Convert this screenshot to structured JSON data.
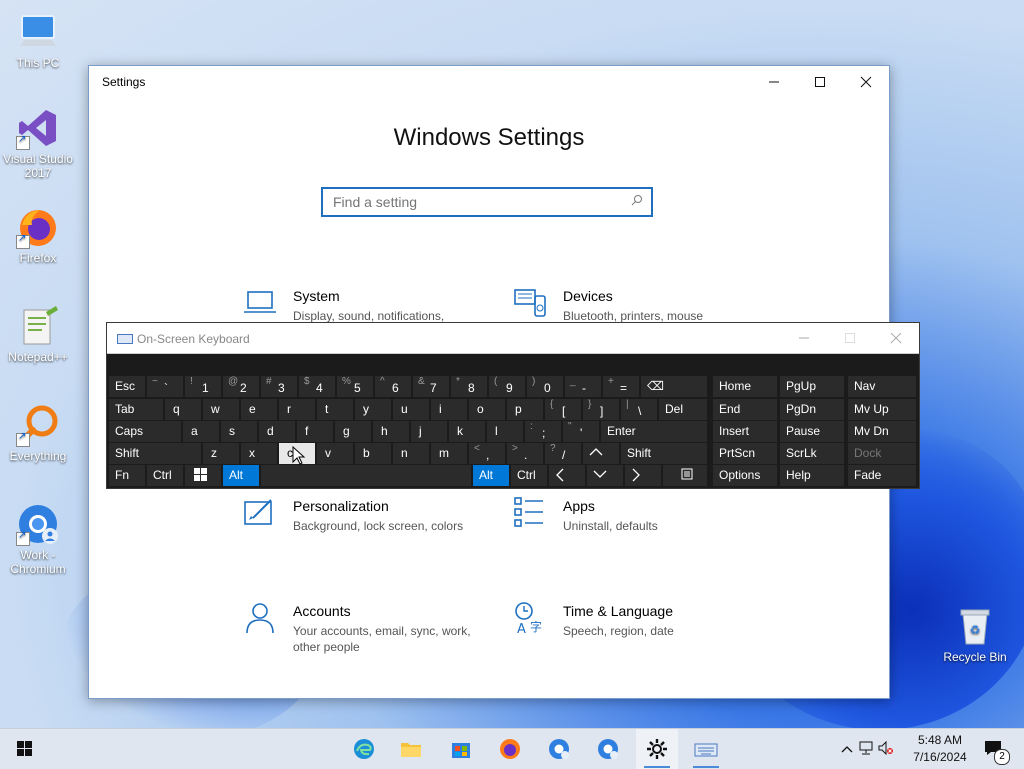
{
  "desktop": {
    "icons": [
      {
        "label": "This PC"
      },
      {
        "label": "Visual Studio 2017"
      },
      {
        "label": "Firefox"
      },
      {
        "label": "Notepad++"
      },
      {
        "label": "Everything"
      },
      {
        "label": "Work - Chromium"
      },
      {
        "label": "Recycle Bin"
      }
    ]
  },
  "settings": {
    "window_title": "Settings",
    "heading": "Windows Settings",
    "search_placeholder": "Find a setting",
    "tiles": [
      {
        "name": "System",
        "desc": "Display, sound, notifications,",
        "icon": "laptop-icon"
      },
      {
        "name": "Devices",
        "desc": "Bluetooth, printers, mouse",
        "icon": "devices-icon"
      },
      {
        "name": "Personalization",
        "desc": "Background, lock screen, colors",
        "icon": "personalization-icon"
      },
      {
        "name": "Apps",
        "desc": "Uninstall, defaults",
        "icon": "apps-icon"
      },
      {
        "name": "Accounts",
        "desc": "Your accounts, email, sync, work, other people",
        "icon": "person-icon"
      },
      {
        "name": "Time & Language",
        "desc": "Speech, region, date",
        "icon": "time-language-icon"
      }
    ]
  },
  "osk": {
    "title": "On-Screen Keyboard",
    "row1": {
      "esc": "Esc",
      "keys": [
        {
          "sub": "~",
          "main": "`"
        },
        {
          "sub": "!",
          "main": "1"
        },
        {
          "sub": "@",
          "main": "2"
        },
        {
          "sub": "#",
          "main": "3"
        },
        {
          "sub": "$",
          "main": "4"
        },
        {
          "sub": "%",
          "main": "5"
        },
        {
          "sub": "^",
          "main": "6"
        },
        {
          "sub": "&",
          "main": "7"
        },
        {
          "sub": "*",
          "main": "8"
        },
        {
          "sub": "(",
          "main": "9"
        },
        {
          "sub": ")",
          "main": "0"
        },
        {
          "sub": "_",
          "main": "-"
        },
        {
          "sub": "+",
          "main": "="
        }
      ],
      "backspace": "⌫"
    },
    "row2": {
      "tab": "Tab",
      "letters": [
        "q",
        "w",
        "e",
        "r",
        "t",
        "y",
        "u",
        "i",
        "o",
        "p"
      ],
      "bracket_keys": [
        {
          "sub": "{",
          "main": "["
        },
        {
          "sub": "}",
          "main": "]"
        },
        {
          "sub": "|",
          "main": "\\"
        }
      ],
      "del": "Del"
    },
    "row3": {
      "caps": "Caps",
      "letters": [
        "a",
        "s",
        "d",
        "f",
        "g",
        "h",
        "j",
        "k",
        "l"
      ],
      "punct": [
        {
          "sub": ":",
          "main": ";"
        },
        {
          "sub": "\"",
          "main": "'"
        }
      ],
      "enter": "Enter"
    },
    "row4": {
      "shift": "Shift",
      "letters": [
        "z",
        "x",
        "c",
        "v",
        "b",
        "n",
        "m"
      ],
      "punct": [
        {
          "sub": "<",
          "main": ","
        },
        {
          "sub": ">",
          "main": "."
        },
        {
          "sub": "?",
          "main": "/"
        }
      ],
      "up": "^",
      "shift_r": "Shift"
    },
    "row5": {
      "fn": "Fn",
      "ctrl": "Ctrl",
      "alt": "Alt",
      "alt_r": "Alt",
      "ctrl_r": "Ctrl",
      "left": "<",
      "down": "v",
      "right": ">"
    },
    "nav": {
      "col1": [
        "Home",
        "End",
        "Insert",
        "PrtScn",
        "Options"
      ],
      "col2": [
        "PgUp",
        "PgDn",
        "Pause",
        "ScrLk",
        "Help"
      ],
      "col3": [
        "Nav",
        "Mv Up",
        "Mv Dn",
        "Dock",
        "Fade"
      ]
    }
  },
  "taskbar": {
    "time": "5:48 AM",
    "date": "7/16/2024",
    "notification_count": "2"
  }
}
